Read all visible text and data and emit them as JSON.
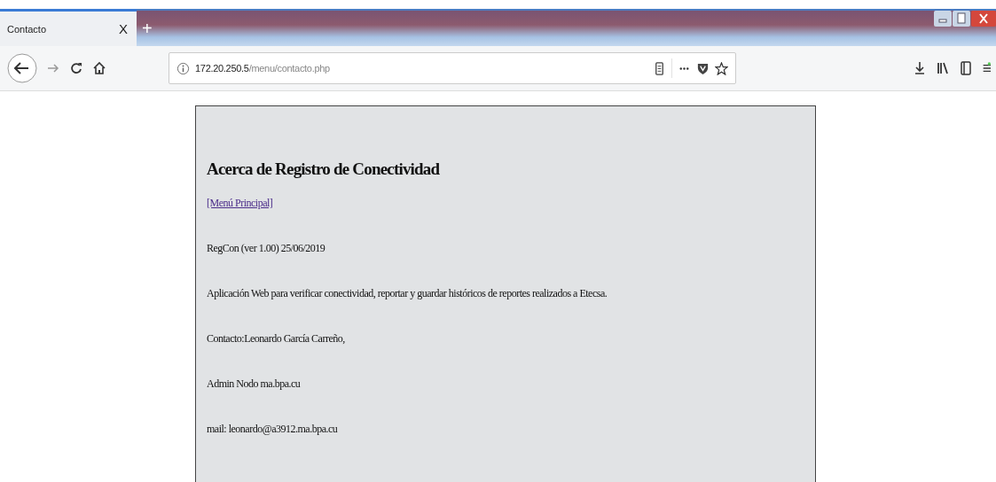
{
  "browser": {
    "tabs": [
      {
        "label": "Contacto",
        "selected": true
      }
    ],
    "close_tab": "X",
    "new_tab": "+",
    "url": {
      "host": "172.20.250.5",
      "path": "/menu/contacto.php"
    }
  },
  "page": {
    "title": "Acerca de Registro de Conectividad",
    "link": "[Menú Principal]",
    "paragraphs": [
      "RegCon (ver 1.00) 25/06/2019",
      "Aplicación Web para verificar conectividad, reportar y guardar históricos de reportes realizados a Etecsa.",
      "Contacto:Leonardo García Carreño,",
      "Admin Nodo ma.bpa.cu",
      "mail: leonardo@a3912.ma.bpa.cu"
    ]
  }
}
